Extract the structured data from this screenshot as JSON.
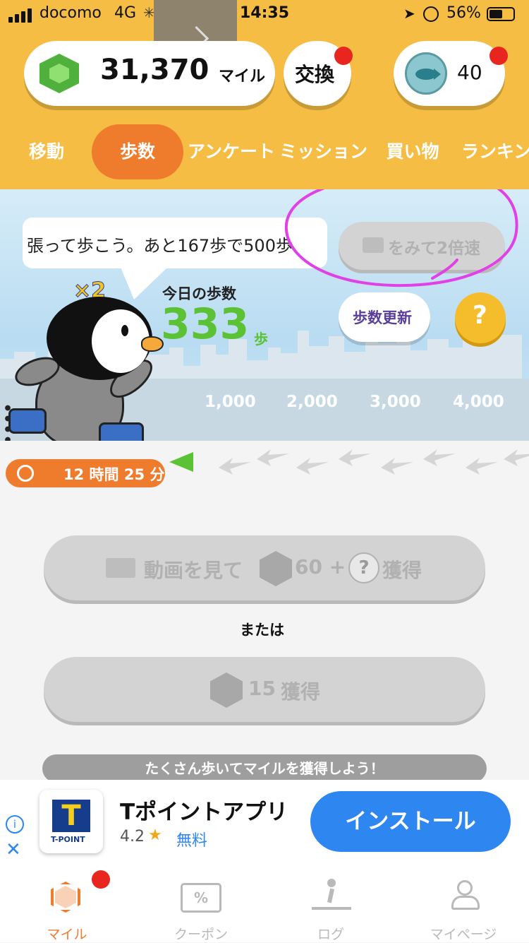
{
  "status_bar": {
    "carrier": "docomo",
    "network": "4G",
    "time": "14:35",
    "battery": "56%"
  },
  "header": {
    "miles_value": "31,370",
    "miles_unit": "マイル",
    "exchange_label": "交換",
    "coin_count": "40"
  },
  "tabs": [
    {
      "label": "移動"
    },
    {
      "label": "歩数"
    },
    {
      "label": "アンケート"
    },
    {
      "label": "ミッション"
    },
    {
      "label": "買い物"
    },
    {
      "label": "ランキン"
    }
  ],
  "scene": {
    "speech_text": "張って歩こう。あと167歩で500歩",
    "double_speed_label": "をみて2倍速",
    "multiplier": "×2",
    "today_steps_label": "今日の歩数",
    "steps_value": "333",
    "steps_unit": "歩",
    "update_button": "歩数更新",
    "help_button": "?",
    "milestones": [
      "1,000",
      "2,000",
      "3,000",
      "4,000"
    ]
  },
  "timer": {
    "text": "12 時間 25 分"
  },
  "actions": {
    "video_button": {
      "text1": "動画を見て",
      "value": "60 +",
      "badge": "?",
      "text2": "獲得"
    },
    "or_text": "または",
    "claim_button": {
      "value": "15",
      "text": "獲得"
    },
    "tip_banner": "たくさん歩いてマイルを獲得しよう！"
  },
  "ad": {
    "app_name": "Tポイントアプリ",
    "rating": "4.2",
    "price": "無料",
    "install_label": "インストール",
    "logo_letter": "T",
    "logo_caption": "T-POINT"
  },
  "bottom_nav": [
    {
      "label": "マイル"
    },
    {
      "label": "クーポン"
    },
    {
      "label": "ログ"
    },
    {
      "label": "マイページ"
    }
  ],
  "colors": {
    "header_bg": "#f5bd43",
    "active_tab": "#ef7b2d",
    "steps_green": "#5cc235",
    "install_blue": "#2e86f0",
    "annotation_magenta": "#e040e6"
  }
}
